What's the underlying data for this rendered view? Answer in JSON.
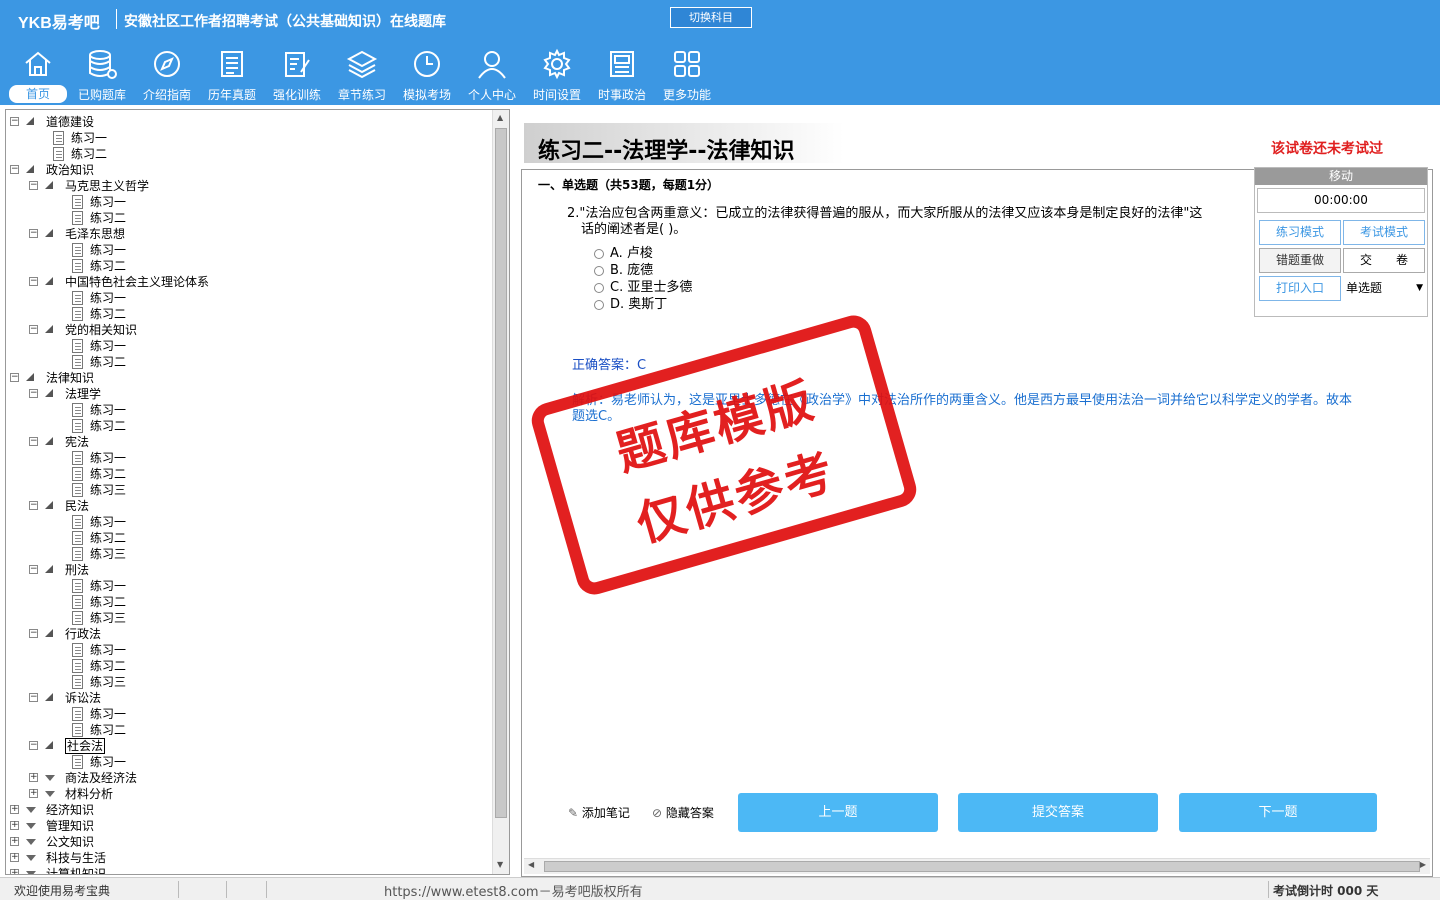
{
  "header": {
    "logo": "YKB易考吧",
    "title": "安徽社区工作者招聘考试（公共基础知识）在线题库",
    "switch_label": "切换科目"
  },
  "toolbar": [
    {
      "label": "首页",
      "icon": "home-icon"
    },
    {
      "label": "已购题库",
      "icon": "database-icon"
    },
    {
      "label": "介绍指南",
      "icon": "compass-icon"
    },
    {
      "label": "历年真题",
      "icon": "document-list-icon"
    },
    {
      "label": "强化训练",
      "icon": "edit-icon"
    },
    {
      "label": "章节练习",
      "icon": "layers-icon"
    },
    {
      "label": "模拟考场",
      "icon": "clock-icon"
    },
    {
      "label": "个人中心",
      "icon": "user-icon"
    },
    {
      "label": "时间设置",
      "icon": "gear-icon"
    },
    {
      "label": "时事政治",
      "icon": "newspaper-icon"
    },
    {
      "label": "更多功能",
      "icon": "grid-icon"
    }
  ],
  "tree": [
    {
      "level": 0,
      "type": "open",
      "label": "道德建设"
    },
    {
      "level": 1,
      "type": "doc",
      "label": "练习一"
    },
    {
      "level": 1,
      "type": "doc",
      "label": "练习二"
    },
    {
      "level": 0,
      "type": "open",
      "label": "政治知识"
    },
    {
      "level": 1,
      "type": "open",
      "label": "马克思主义哲学"
    },
    {
      "level": 2,
      "type": "doc",
      "label": "练习一"
    },
    {
      "level": 2,
      "type": "doc",
      "label": "练习二"
    },
    {
      "level": 1,
      "type": "open",
      "label": "毛泽东思想"
    },
    {
      "level": 2,
      "type": "doc",
      "label": "练习一"
    },
    {
      "level": 2,
      "type": "doc",
      "label": "练习二"
    },
    {
      "level": 1,
      "type": "open",
      "label": "中国特色社会主义理论体系"
    },
    {
      "level": 2,
      "type": "doc",
      "label": "练习一"
    },
    {
      "level": 2,
      "type": "doc",
      "label": "练习二"
    },
    {
      "level": 1,
      "type": "open",
      "label": "党的相关知识"
    },
    {
      "level": 2,
      "type": "doc",
      "label": "练习一"
    },
    {
      "level": 2,
      "type": "doc",
      "label": "练习二"
    },
    {
      "level": 0,
      "type": "open",
      "label": "法律知识"
    },
    {
      "level": 1,
      "type": "open",
      "label": "法理学"
    },
    {
      "level": 2,
      "type": "doc",
      "label": "练习一"
    },
    {
      "level": 2,
      "type": "doc",
      "label": "练习二"
    },
    {
      "level": 1,
      "type": "open",
      "label": "宪法"
    },
    {
      "level": 2,
      "type": "doc",
      "label": "练习一"
    },
    {
      "level": 2,
      "type": "doc",
      "label": "练习二"
    },
    {
      "level": 2,
      "type": "doc",
      "label": "练习三"
    },
    {
      "level": 1,
      "type": "open",
      "label": "民法"
    },
    {
      "level": 2,
      "type": "doc",
      "label": "练习一"
    },
    {
      "level": 2,
      "type": "doc",
      "label": "练习二"
    },
    {
      "level": 2,
      "type": "doc",
      "label": "练习三"
    },
    {
      "level": 1,
      "type": "open",
      "label": "刑法"
    },
    {
      "level": 2,
      "type": "doc",
      "label": "练习一"
    },
    {
      "level": 2,
      "type": "doc",
      "label": "练习二"
    },
    {
      "level": 2,
      "type": "doc",
      "label": "练习三"
    },
    {
      "level": 1,
      "type": "open",
      "label": "行政法"
    },
    {
      "level": 2,
      "type": "doc",
      "label": "练习一"
    },
    {
      "level": 2,
      "type": "doc",
      "label": "练习二"
    },
    {
      "level": 2,
      "type": "doc",
      "label": "练习三"
    },
    {
      "level": 1,
      "type": "open",
      "label": "诉讼法"
    },
    {
      "level": 2,
      "type": "doc",
      "label": "练习一"
    },
    {
      "level": 2,
      "type": "doc",
      "label": "练习二"
    },
    {
      "level": 1,
      "type": "open",
      "label": "社会法",
      "selected": true
    },
    {
      "level": 2,
      "type": "doc",
      "label": "练习一"
    },
    {
      "level": 1,
      "type": "closed",
      "label": "商法及经济法"
    },
    {
      "level": 1,
      "type": "closed",
      "label": "材料分析"
    },
    {
      "level": 0,
      "type": "closed",
      "label": "经济知识"
    },
    {
      "level": 0,
      "type": "closed",
      "label": "管理知识"
    },
    {
      "level": 0,
      "type": "closed",
      "label": "公文知识"
    },
    {
      "level": 0,
      "type": "closed",
      "label": "科技与生活"
    },
    {
      "level": 0,
      "type": "closed",
      "label": "计算机知识"
    }
  ],
  "exam": {
    "title": "练习二--法理学--法律知识",
    "status": "该试卷还未考试过",
    "section": "一、单选题（共53题，每题1分）",
    "question_line1": "2.\"法治应包含两重意义：已成立的法律获得普遍的服从，而大家所服从的法律又应该本身是制定良好的法律\"这",
    "question_line2": "话的阐述者是(  )。",
    "options": [
      "A. 卢梭",
      "B. 庞德",
      "C. 亚里士多德",
      "D. 奥斯丁"
    ],
    "answer": "正确答案：C",
    "analysis": "解析：易老师认为，这是亚里士多德在《政治学》中对法治所作的两重含义。他是西方最早使用法治一词并给它以科学定义的学者。故本题选C。"
  },
  "panel": {
    "move": "移动",
    "timer": "00:00:00",
    "practice_mode": "练习模式",
    "exam_mode": "考试模式",
    "redo_wrong": "错题重做",
    "submit_paper": "交　　卷",
    "print": "打印入口",
    "type_select": "单选题"
  },
  "bottom": {
    "add_note": "添加笔记",
    "hide_answer": "隐藏答案",
    "prev": "上一题",
    "submit": "提交答案",
    "next": "下一题"
  },
  "watermark": {
    "line1": "题库模版",
    "line2": "仅供参考"
  },
  "status": {
    "welcome": "欢迎使用易考宝典",
    "copyright": "https://www.etest8.com－易考吧版权所有",
    "countdown": "考试倒计时 000 天"
  },
  "colors": {
    "brand_blue": "#3c97e3",
    "button_blue": "#4cb8f5",
    "stamp_red": "#e01010",
    "status_red": "#e02020"
  }
}
